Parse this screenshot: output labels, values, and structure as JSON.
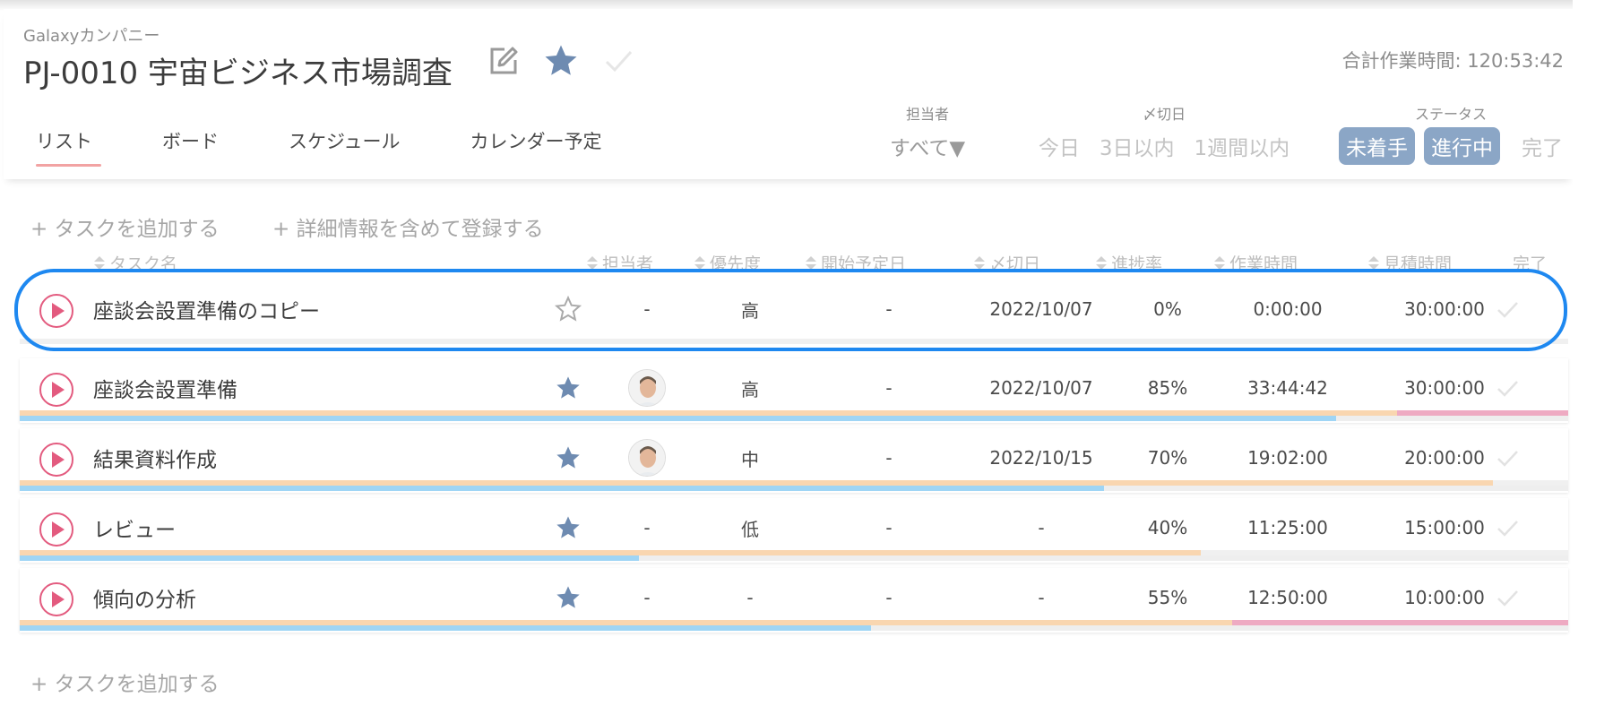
{
  "header": {
    "company": "Galaxyカンパニー",
    "project_title": "PJ-0010 宇宙ビジネス市場調査",
    "total_time": "合計作業時間: 120:53:42"
  },
  "tabs": [
    {
      "label": "リスト",
      "active": true
    },
    {
      "label": "ボード"
    },
    {
      "label": "スケジュール"
    },
    {
      "label": "カレンダー予定"
    }
  ],
  "filters": {
    "assignee_label": "担当者",
    "assignee_value": "すべて▼",
    "due_label": "〆切日",
    "due_options": [
      "今日",
      "3日以内",
      "1週間以内"
    ],
    "status_label": "ステータス",
    "status_options": [
      "未着手",
      "進行中",
      "完了"
    ]
  },
  "actions": {
    "add_task": "+ タスクを追加する",
    "add_detailed": "+ 詳細情報を含めて登録する",
    "add_task_bottom": "+ タスクを追加する"
  },
  "columns": {
    "task_name": "タスク名",
    "assignee": "担当者",
    "priority": "優先度",
    "start_date": "開始予定日",
    "due_date": "〆切日",
    "progress": "進捗率",
    "work_time": "作業時間",
    "estimate": "見積時間",
    "done": "完了"
  },
  "tasks": [
    {
      "name": "座談会設置準備のコピー",
      "starred": false,
      "assignee": "-",
      "priority": "高",
      "start_date": "-",
      "due_date": "2022/10/07",
      "progress": "0%",
      "work_time": "0:00:00",
      "estimate": "30:00:00"
    },
    {
      "name": "座談会設置準備",
      "starred": true,
      "assignee": "avatar",
      "priority": "高",
      "start_date": "-",
      "due_date": "2022/10/07",
      "progress": "85%",
      "work_time": "33:44:42",
      "estimate": "30:00:00"
    },
    {
      "name": "結果資料作成",
      "starred": true,
      "assignee": "avatar",
      "priority": "中",
      "start_date": "-",
      "due_date": "2022/10/15",
      "progress": "70%",
      "work_time": "19:02:00",
      "estimate": "20:00:00"
    },
    {
      "name": "レビュー",
      "starred": true,
      "assignee": "-",
      "priority": "低",
      "start_date": "-",
      "due_date": "-",
      "progress": "40%",
      "work_time": "11:25:00",
      "estimate": "15:00:00"
    },
    {
      "name": "傾向の分析",
      "starred": true,
      "assignee": "-",
      "priority": "-",
      "start_date": "-",
      "due_date": "-",
      "progress": "55%",
      "work_time": "12:50:00",
      "estimate": "10:00:00"
    }
  ],
  "colors": {
    "accent_blue": "#8ba6c6",
    "play_red": "#e35b7f",
    "highlight": "#1e88f0",
    "progress_bar": "#9fd5f5",
    "time_bar": "#f9d6b0",
    "overtime_bar": "#eeaac2"
  }
}
